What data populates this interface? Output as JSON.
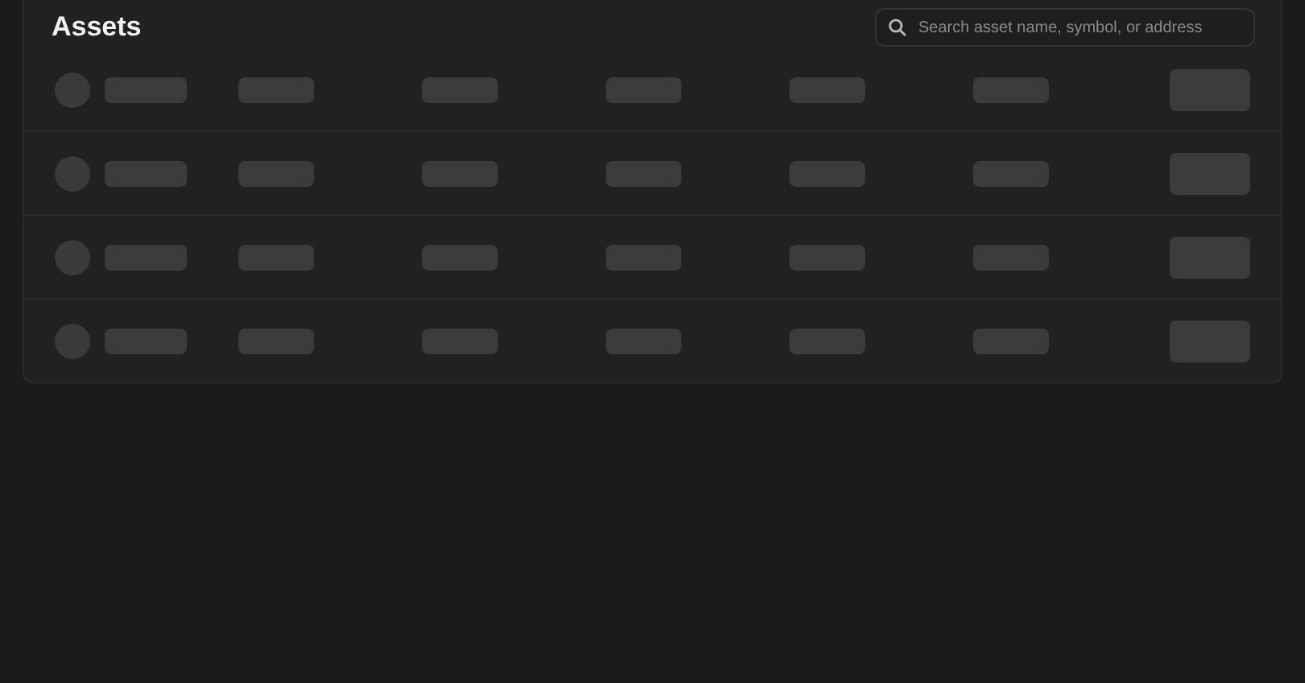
{
  "title": "Assets",
  "search": {
    "placeholder": "Search asset name, symbol, or address"
  },
  "rows": [
    {
      "cells": [
        {
          "kind": "avatar-bar"
        },
        {
          "kind": "bar"
        },
        {
          "kind": "bar"
        },
        {
          "kind": "bar"
        },
        {
          "kind": "bar"
        },
        {
          "kind": "bar"
        },
        {
          "kind": "button"
        }
      ]
    },
    {
      "cells": [
        {
          "kind": "avatar-bar"
        },
        {
          "kind": "bar"
        },
        {
          "kind": "bar"
        },
        {
          "kind": "bar"
        },
        {
          "kind": "bar"
        },
        {
          "kind": "bar"
        },
        {
          "kind": "button"
        }
      ]
    },
    {
      "cells": [
        {
          "kind": "avatar-bar"
        },
        {
          "kind": "bar"
        },
        {
          "kind": "bar"
        },
        {
          "kind": "bar"
        },
        {
          "kind": "bar"
        },
        {
          "kind": "bar"
        },
        {
          "kind": "button"
        }
      ]
    },
    {
      "cells": [
        {
          "kind": "avatar-bar"
        },
        {
          "kind": "bar"
        },
        {
          "kind": "bar"
        },
        {
          "kind": "bar"
        },
        {
          "kind": "bar"
        },
        {
          "kind": "bar"
        },
        {
          "kind": "button"
        }
      ]
    }
  ]
}
